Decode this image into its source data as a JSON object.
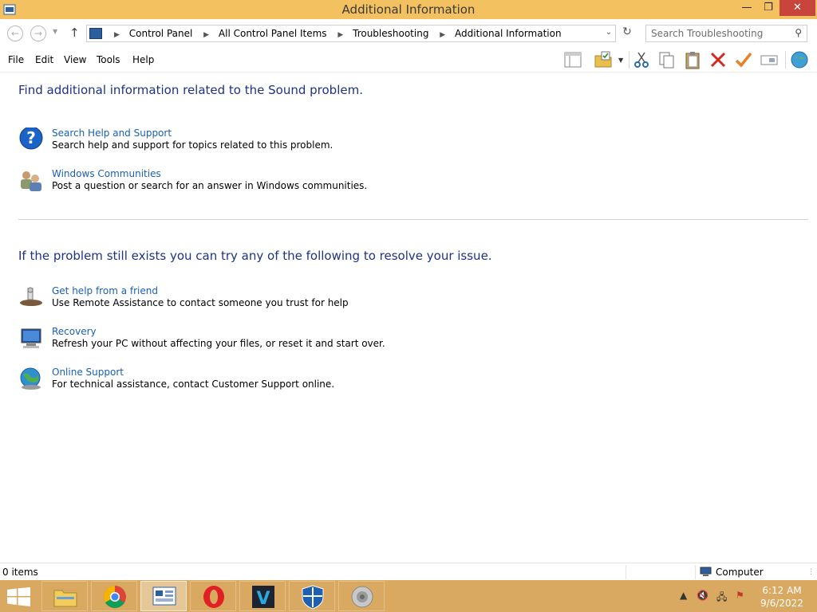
{
  "window": {
    "title": "Additional Information"
  },
  "address": {
    "crumbs": [
      "Control Panel",
      "All Control Panel Items",
      "Troubleshooting",
      "Additional Information"
    ]
  },
  "search": {
    "placeholder": "Search Troubleshooting"
  },
  "menu": {
    "file": "File",
    "edit": "Edit",
    "view": "View",
    "tools": "Tools",
    "help": "Help"
  },
  "section1": {
    "heading": "Find additional information related to the Sound problem.",
    "items": [
      {
        "link": "Search Help and Support",
        "desc": "Search help and support for topics related to this problem.",
        "icon": "question-icon"
      },
      {
        "link": "Windows Communities",
        "desc": "Post a question or search for an answer in Windows communities.",
        "icon": "communities-icon"
      }
    ]
  },
  "section2": {
    "heading": "If the problem still exists you can try any of the following to resolve your issue.",
    "items": [
      {
        "link": "Get help from a friend",
        "desc": "Use Remote Assistance to contact someone you trust for help",
        "icon": "remote-assistance-icon"
      },
      {
        "link": "Recovery",
        "desc": "Refresh your PC without affecting your files, or reset it and start over.",
        "icon": "recovery-icon"
      },
      {
        "link": "Online Support",
        "desc": "For technical assistance, contact Customer Support online.",
        "icon": "globe-icon"
      }
    ]
  },
  "status": {
    "items": "0 items",
    "location": "Computer"
  },
  "clock": {
    "time": "6:12 AM",
    "date": "9/6/2022"
  },
  "colors": {
    "titlebar": "#f3c15f",
    "taskbar": "#d9a961",
    "heading": "#1e3287",
    "link": "#1a5fb4",
    "close": "#c7453b"
  }
}
